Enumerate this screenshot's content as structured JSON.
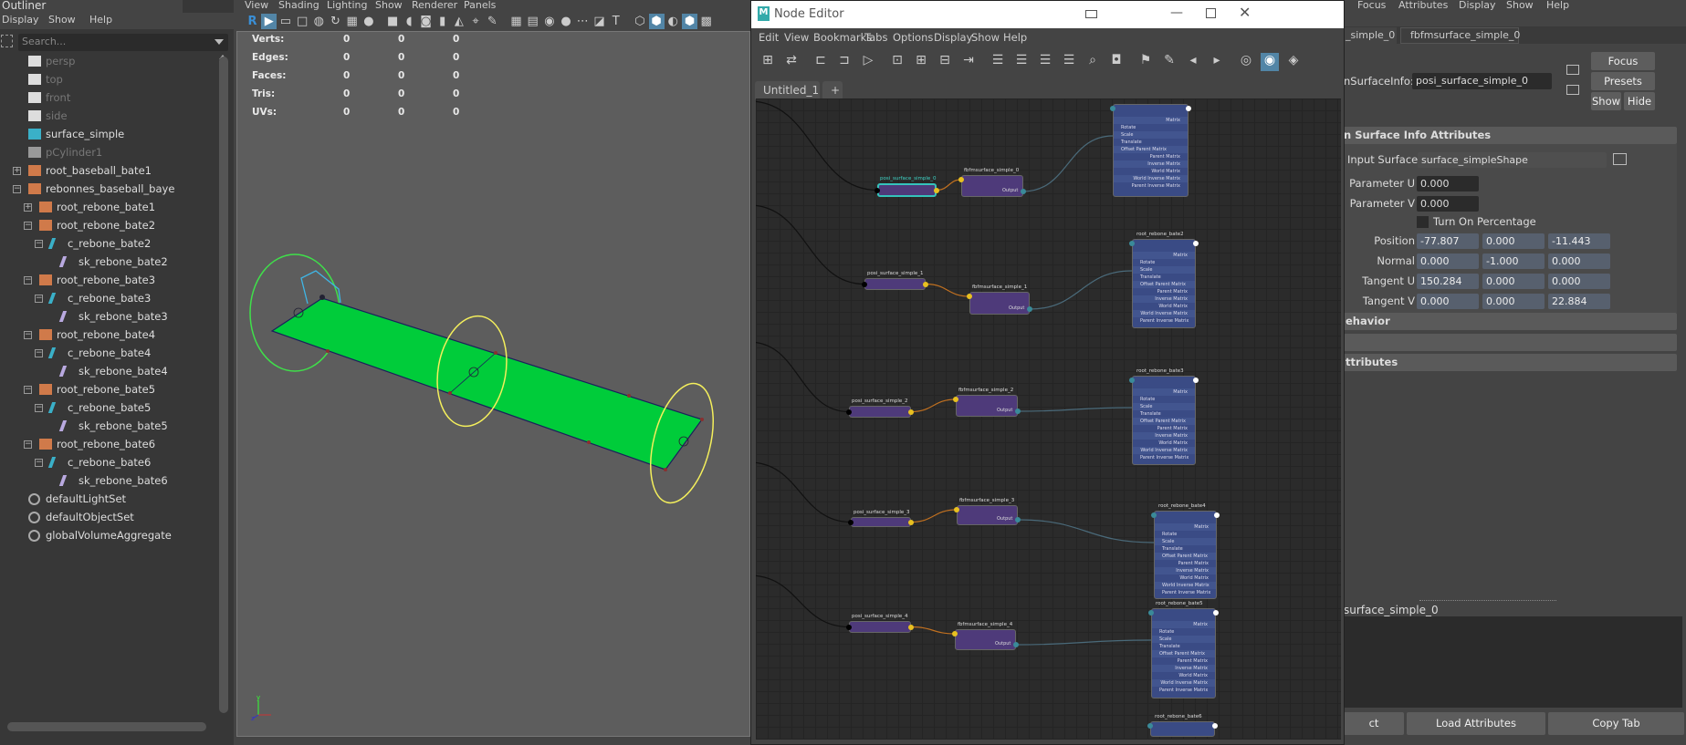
{
  "outliner": {
    "title": "Outliner",
    "menu": [
      "Display",
      "Show",
      "Help"
    ],
    "search_placeholder": "Search...",
    "items": [
      {
        "label": "persp",
        "icon": "camera-icon",
        "dim": true,
        "indent": 0
      },
      {
        "label": "top",
        "icon": "camera-icon",
        "dim": true,
        "indent": 0
      },
      {
        "label": "front",
        "icon": "camera-icon",
        "dim": true,
        "indent": 0
      },
      {
        "label": "side",
        "icon": "camera-icon",
        "dim": true,
        "indent": 0
      },
      {
        "label": "surface_simple",
        "icon": "nurbs-surface-icon",
        "indent": 0
      },
      {
        "label": "pCylinder1",
        "icon": "mesh-icon",
        "dim": true,
        "indent": 0
      },
      {
        "label": "root_baseball_bate1",
        "icon": "joint-transform-icon",
        "indent": 0,
        "expand": "+"
      },
      {
        "label": "rebonnes_baseball_baye",
        "icon": "joint-transform-icon",
        "indent": 0,
        "expand": "-"
      },
      {
        "label": "root_rebone_bate1",
        "icon": "joint-transform-icon",
        "indent": 1,
        "expand": "+"
      },
      {
        "label": "root_rebone_bate2",
        "icon": "joint-transform-icon",
        "indent": 1,
        "expand": "-"
      },
      {
        "label": "c_rebone_bate2",
        "icon": "curve-icon",
        "indent": 2,
        "expand": "-"
      },
      {
        "label": "sk_rebone_bate2",
        "icon": "joint-icon",
        "indent": 3
      },
      {
        "label": "root_rebone_bate3",
        "icon": "joint-transform-icon",
        "indent": 1,
        "expand": "-"
      },
      {
        "label": "c_rebone_bate3",
        "icon": "curve-icon",
        "indent": 2,
        "expand": "-"
      },
      {
        "label": "sk_rebone_bate3",
        "icon": "joint-icon",
        "indent": 3
      },
      {
        "label": "root_rebone_bate4",
        "icon": "joint-transform-icon",
        "indent": 1,
        "expand": "-"
      },
      {
        "label": "c_rebone_bate4",
        "icon": "curve-icon",
        "indent": 2,
        "expand": "-"
      },
      {
        "label": "sk_rebone_bate4",
        "icon": "joint-icon",
        "indent": 3
      },
      {
        "label": "root_rebone_bate5",
        "icon": "joint-transform-icon",
        "indent": 1,
        "expand": "-"
      },
      {
        "label": "c_rebone_bate5",
        "icon": "curve-icon",
        "indent": 2,
        "expand": "-"
      },
      {
        "label": "sk_rebone_bate5",
        "icon": "joint-icon",
        "indent": 3
      },
      {
        "label": "root_rebone_bate6",
        "icon": "joint-transform-icon",
        "indent": 1,
        "expand": "-"
      },
      {
        "label": "c_rebone_bate6",
        "icon": "curve-icon",
        "indent": 2,
        "expand": "-"
      },
      {
        "label": "sk_rebone_bate6",
        "icon": "joint-icon",
        "indent": 3
      },
      {
        "label": "defaultLightSet",
        "icon": "set-icon",
        "indent": 0
      },
      {
        "label": "defaultObjectSet",
        "icon": "set-icon",
        "indent": 0
      },
      {
        "label": "globalVolumeAggregate",
        "icon": "volume-icon",
        "indent": 0
      }
    ]
  },
  "viewport": {
    "menu": [
      "View",
      "Shading",
      "Lighting",
      "Show",
      "Renderer",
      "Panels"
    ],
    "hud": [
      {
        "label": "Verts:",
        "values": [
          "0",
          "0",
          "0"
        ]
      },
      {
        "label": "Edges:",
        "values": [
          "0",
          "0",
          "0"
        ]
      },
      {
        "label": "Faces:",
        "values": [
          "0",
          "0",
          "0"
        ]
      },
      {
        "label": "Tris:",
        "values": [
          "0",
          "0",
          "0"
        ]
      },
      {
        "label": "UVs:",
        "values": [
          "0",
          "0",
          "0"
        ]
      }
    ],
    "axis": {
      "y": "y",
      "z": "z"
    },
    "colors": {
      "surface": "#00cc3a",
      "selected_ring": "#3fe04a",
      "ring": "#f4ef5c",
      "curve": "#3fb6e6"
    }
  },
  "node_editor": {
    "title": "Node Editor",
    "menu": [
      "Edit",
      "View",
      "Bookmarks",
      "Tabs",
      "Options",
      "Display",
      "Show",
      "Help"
    ],
    "tabs": [
      {
        "label": "Untitled_1",
        "close": "✕"
      },
      {
        "label": "+"
      }
    ],
    "root_attrs": [
      "Matrix",
      "Rotate",
      "Scale",
      "Translate",
      "Offset Parent Matrix",
      "Parent Matrix",
      "Inverse Matrix",
      "World Matrix",
      "World Inverse Matrix",
      "Parent Inverse Matrix"
    ],
    "output_label": "Output",
    "rows": [
      {
        "posi": "posi_surface_simple_0",
        "fb": "fbfmsurface_simple_0",
        "root": "",
        "selected": true
      },
      {
        "posi": "posi_surface_simple_1",
        "fb": "fbfmsurface_simple_1",
        "root": "root_rebone_bate2"
      },
      {
        "posi": "posi_surface_simple_2",
        "fb": "fbfmsurface_simple_2",
        "root": "root_rebone_bate3"
      },
      {
        "posi": "posi_surface_simple_3",
        "fb": "fbfmsurface_simple_3",
        "root": "root_rebone_bate4"
      },
      {
        "posi": "posi_surface_simple_4",
        "fb": "fbfmsurface_simple_4",
        "root": "root_rebone_bate5"
      },
      {
        "posi": "",
        "fb": "",
        "root": "root_rebone_bate6"
      }
    ]
  },
  "attribute_editor": {
    "menu": [
      "Focus",
      "Attributes",
      "Display",
      "Show",
      "Help"
    ],
    "tabs": [
      "_simple_0",
      "fbfmsurface_simple_0"
    ],
    "node_type_label": "nSurfaceInfo:",
    "node_name": "posi_surface_simple_0",
    "buttons": {
      "focus": "Focus",
      "presets": "Presets",
      "show": "Show",
      "hide": "Hide"
    },
    "section_main": "n Surface Info Attributes",
    "input_surface": {
      "label": "Input Surface",
      "value": "surface_simpleShape"
    },
    "parameter_u": {
      "label": "Parameter U",
      "value": "0.000"
    },
    "parameter_v": {
      "label": "Parameter V",
      "value": "0.000"
    },
    "turn_on_percentage": {
      "label": "Turn On Percentage",
      "checked": false
    },
    "vectors": [
      {
        "label": "Position",
        "values": [
          "-77.807",
          "0.000",
          "-11.443"
        ]
      },
      {
        "label": "Normal",
        "values": [
          "0.000",
          "-1.000",
          "0.000"
        ]
      },
      {
        "label": "Tangent U",
        "values": [
          "150.284",
          "0.000",
          "0.000"
        ]
      },
      {
        "label": "Tangent V",
        "values": [
          "0.000",
          "0.000",
          "22.884"
        ]
      }
    ],
    "sections": [
      "ehavior",
      "",
      "ttributes"
    ],
    "notes_label": "surface_simple_0",
    "bottom_buttons": [
      "ct",
      "Load Attributes",
      "Copy Tab"
    ]
  }
}
